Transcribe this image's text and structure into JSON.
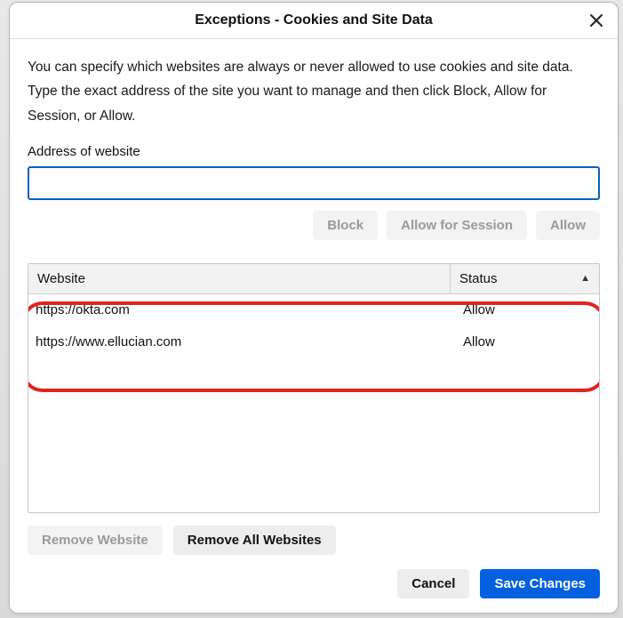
{
  "dialog": {
    "title": "Exceptions - Cookies and Site Data",
    "description": "You can specify which websites are always or never allowed to use cookies and site data. Type the exact address of the site you want to manage and then click Block, Allow for Session, or Allow.",
    "address_label": "Address of website",
    "address_value": "",
    "buttons": {
      "block": "Block",
      "allow_session": "Allow for Session",
      "allow": "Allow",
      "remove_one": "Remove Website",
      "remove_all": "Remove All Websites",
      "cancel": "Cancel",
      "save": "Save Changes"
    },
    "table": {
      "headers": {
        "website": "Website",
        "status": "Status"
      },
      "sort": {
        "column": "status",
        "direction": "asc"
      },
      "rows": [
        {
          "website": "https://okta.com",
          "status": "Allow"
        },
        {
          "website": "https://www.ellucian.com",
          "status": "Allow"
        }
      ]
    }
  }
}
